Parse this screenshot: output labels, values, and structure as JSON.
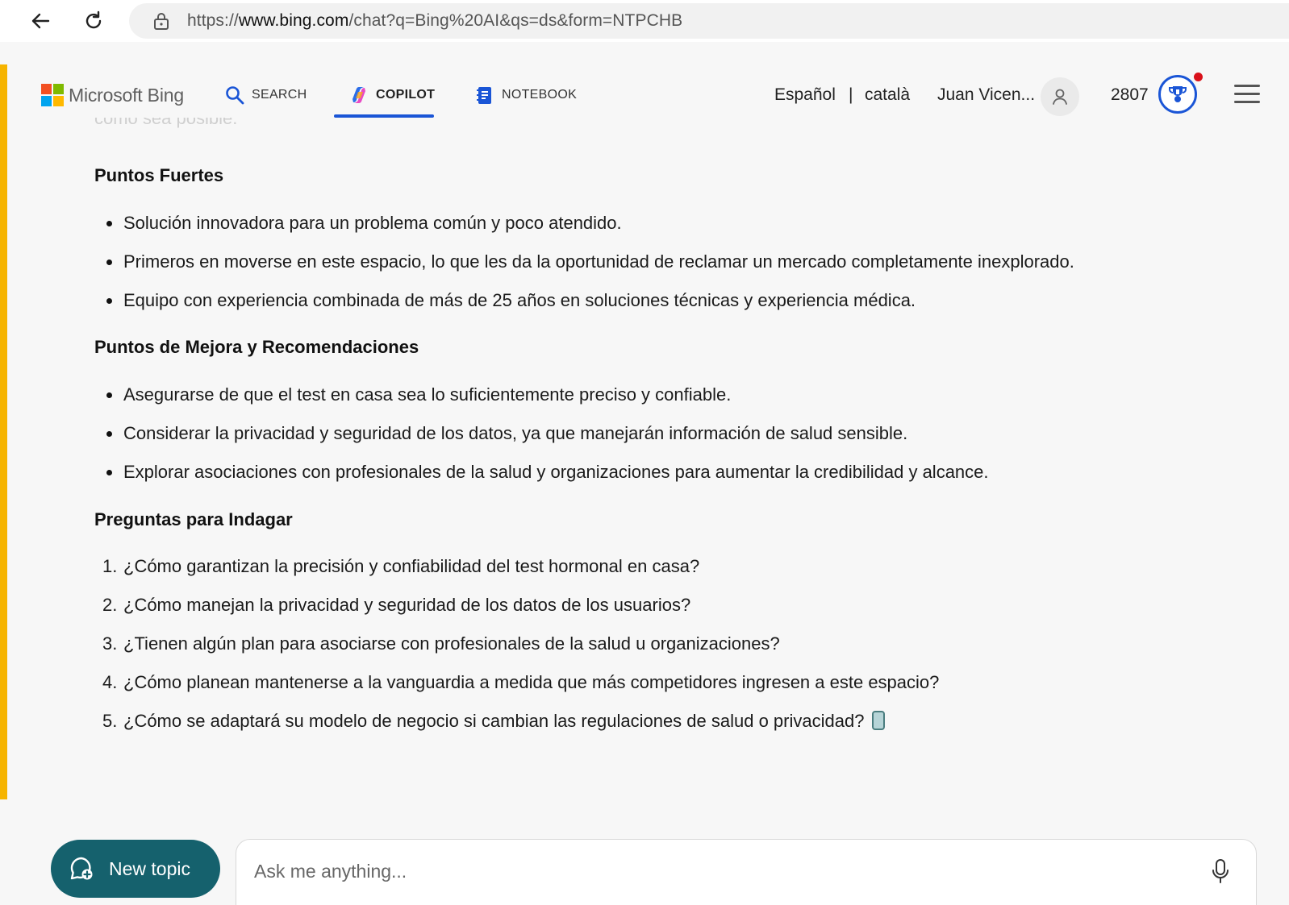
{
  "browser": {
    "url_prefix": "https://",
    "url_host": "www.bing.com",
    "url_path": "/chat?q=Bing%20AI&qs=ds&form=NTPCHB"
  },
  "header": {
    "logo_text": "Microsoft Bing",
    "tabs": [
      {
        "label": "SEARCH",
        "icon": "search-icon"
      },
      {
        "label": "COPILOT",
        "icon": "copilot-icon",
        "active": true
      },
      {
        "label": "NOTEBOOK",
        "icon": "notebook-icon"
      }
    ],
    "languages": [
      "Español",
      "català"
    ],
    "lang_separator": "|",
    "user_name": "Juan Vicen...",
    "points": "2807"
  },
  "content": {
    "faded_line": "como sea posible.",
    "sections": [
      {
        "title": "Puntos Fuertes",
        "items": [
          "Solución innovadora para un problema común y poco atendido.",
          "Primeros en moverse en este espacio, lo que les da la oportunidad de reclamar un mercado completamente inexplorado.",
          "Equipo con experiencia combinada de más de 25 años en soluciones técnicas y experiencia médica."
        ]
      },
      {
        "title": "Puntos de Mejora y Recomendaciones",
        "items": [
          "Asegurarse de que el test en casa sea lo suficientemente preciso y confiable.",
          "Considerar la privacidad y seguridad de los datos, ya que manejarán información de salud sensible.",
          "Explorar asociaciones con profesionales de la salud y organizaciones para aumentar la credibilidad y alcance."
        ]
      },
      {
        "title": "Preguntas para Indagar",
        "items": [
          "¿Cómo garantizan la precisión y confiabilidad del test hormonal en casa?",
          "¿Cómo manejan la privacidad y seguridad de los datos de los usuarios?",
          "¿Tienen algún plan para asociarse con profesionales de la salud u organizaciones?",
          "¿Cómo planean mantenerse a la vanguardia a medida que más competidores ingresen a este espacio?",
          "¿Cómo se adaptará su modelo de negocio si cambian las regulaciones de salud o privacidad?"
        ],
        "numbers": [
          "1.",
          "2.",
          "3.",
          "4.",
          "5."
        ]
      }
    ]
  },
  "footer": {
    "new_topic_label": "New topic",
    "ask_placeholder": "Ask me anything..."
  },
  "colors": {
    "accent_stripe": "#f6b400",
    "tab_underline": "#1a55d6",
    "new_topic_bg": "#15616d",
    "notification": "#d9111a"
  }
}
